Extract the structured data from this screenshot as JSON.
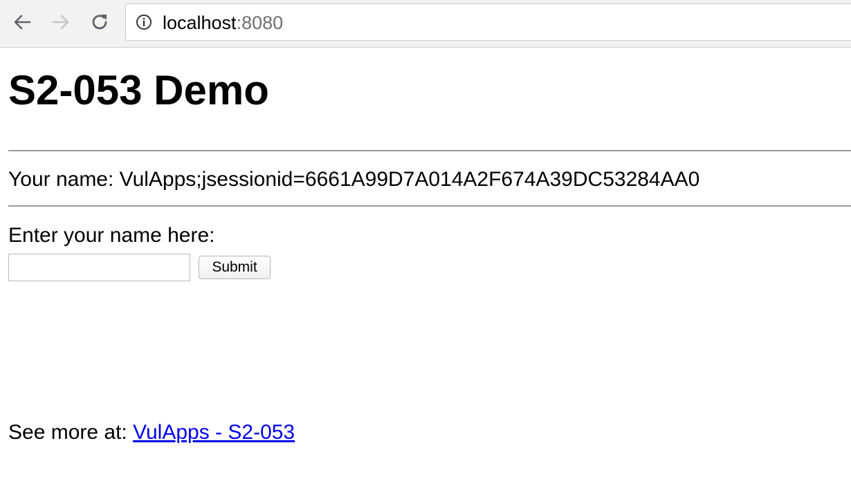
{
  "browser": {
    "back_icon": "arrow-left-icon",
    "forward_icon": "arrow-right-icon",
    "reload_icon": "reload-icon",
    "info_icon": "info-circle-icon",
    "url_host": "localhost",
    "url_port": ":8080"
  },
  "page": {
    "title": "S2-053 Demo",
    "name_label": "Your name: ",
    "name_value": "VulApps;jsessionid=6661A99D7A014A2F674A39DC53284AA0",
    "prompt": "Enter your name here:",
    "input_value": "",
    "submit_label": "Submit",
    "footer_prefix": "See more at: ",
    "footer_link_text": "VulApps - S2-053"
  },
  "colors": {
    "link": "#0000ee",
    "toolbar_bg": "#f2f2f2",
    "port_text": "#6f6f6f"
  }
}
